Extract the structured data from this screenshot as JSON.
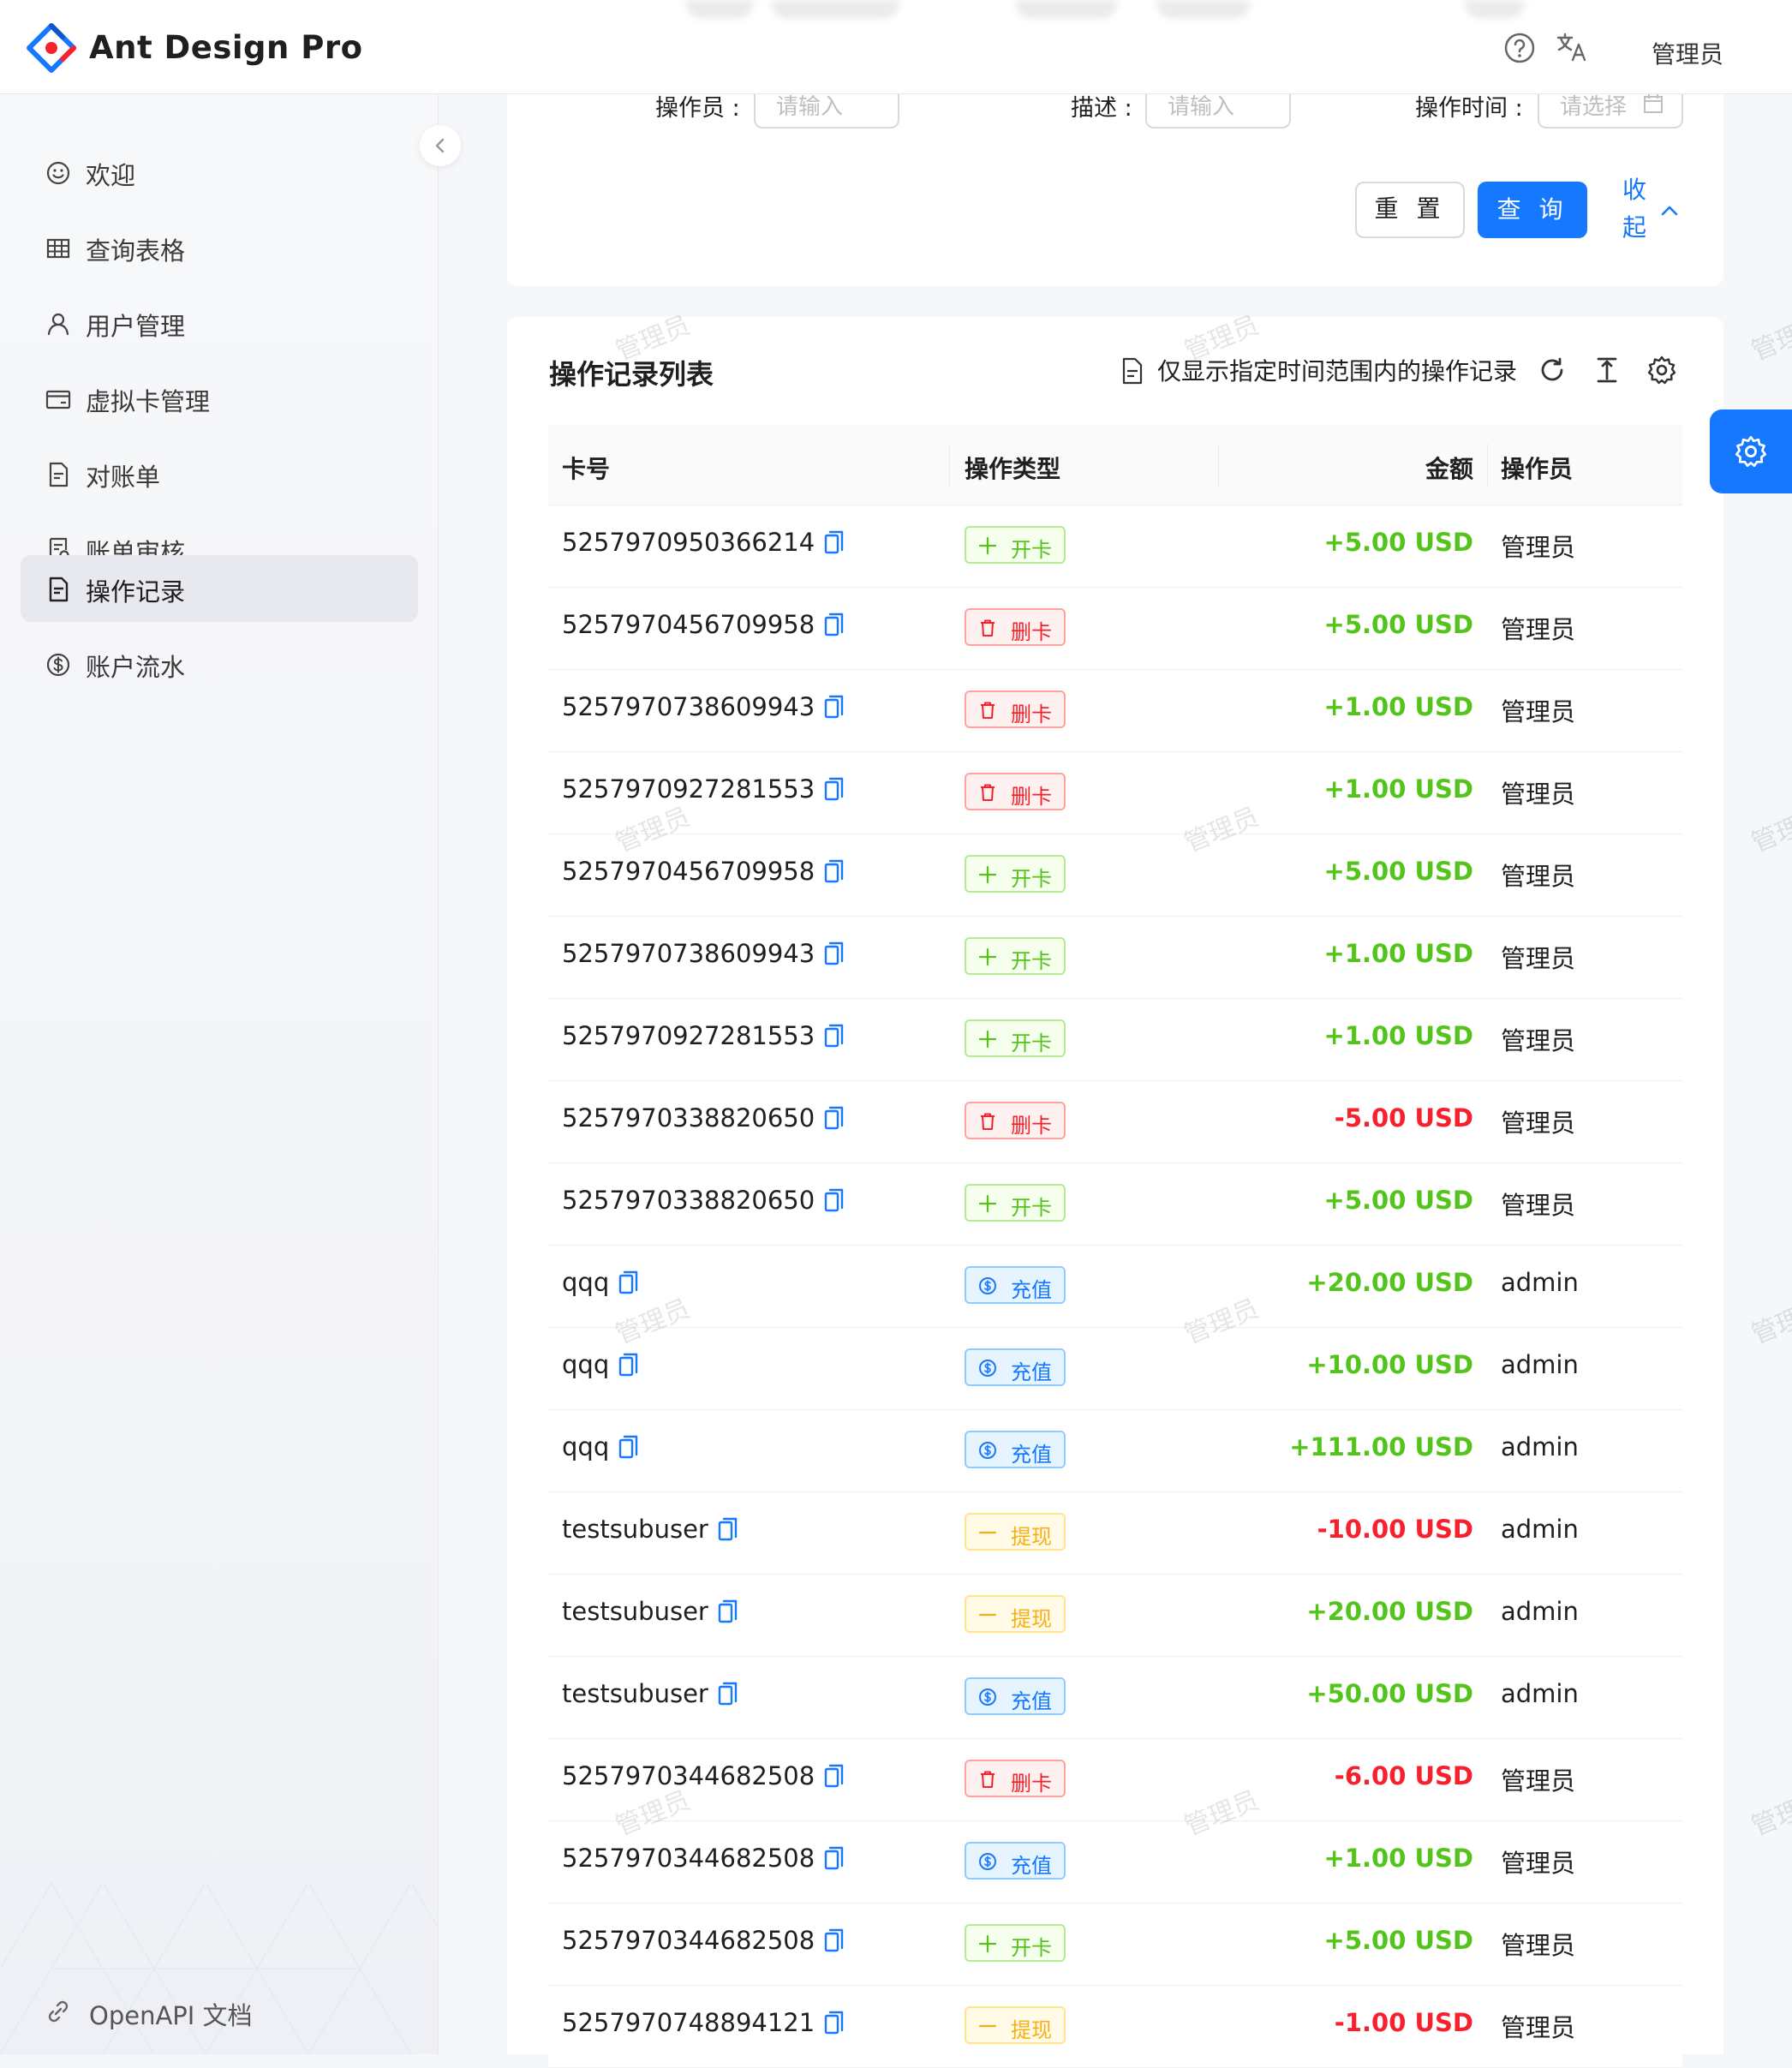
{
  "app": {
    "title": "Ant Design Pro"
  },
  "header": {
    "user": "管理员",
    "help_icon": "question-circle-icon",
    "lang_icon": "translation-icon"
  },
  "sidebar": {
    "items": [
      {
        "label": "欢迎",
        "icon": "smile-icon",
        "active": false
      },
      {
        "label": "查询表格",
        "icon": "table-icon",
        "active": false
      },
      {
        "label": "用户管理",
        "icon": "user-icon",
        "active": false
      },
      {
        "label": "虚拟卡管理",
        "icon": "credit-card-icon",
        "active": false
      },
      {
        "label": "对账单",
        "icon": "file-text-icon",
        "active": false
      },
      {
        "label": "账单审核",
        "icon": "audit-icon",
        "active": false
      },
      {
        "label": "操作记录",
        "icon": "file-text-icon",
        "active": true
      },
      {
        "label": "账户流水",
        "icon": "dollar-circle-icon",
        "active": false
      }
    ],
    "footer_link": "OpenAPI 文档"
  },
  "search": {
    "fields": [
      {
        "label": "操作员 :",
        "placeholder": "请输入"
      },
      {
        "label": "描述 :",
        "placeholder": "请输入"
      },
      {
        "label": "操作时间 :",
        "placeholder": "请选择"
      }
    ],
    "reset_label": "重 置",
    "query_label": "查 询",
    "collapse_label": "收起"
  },
  "table": {
    "title": "操作记录列表",
    "toolbar_note": "仅显示指定时间范围内的操作记录",
    "columns": [
      "卡号",
      "操作类型",
      "金额",
      "操作员"
    ],
    "rows": [
      {
        "card": "5257970950366214",
        "type": "开卡",
        "type_kind": "open",
        "amount": "+5.00 USD",
        "operator": "管理员"
      },
      {
        "card": "5257970456709958",
        "type": "删卡",
        "type_kind": "delete",
        "amount": "+5.00 USD",
        "operator": "管理员"
      },
      {
        "card": "5257970738609943",
        "type": "删卡",
        "type_kind": "delete",
        "amount": "+1.00 USD",
        "operator": "管理员"
      },
      {
        "card": "5257970927281553",
        "type": "删卡",
        "type_kind": "delete",
        "amount": "+1.00 USD",
        "operator": "管理员"
      },
      {
        "card": "5257970456709958",
        "type": "开卡",
        "type_kind": "open",
        "amount": "+5.00 USD",
        "operator": "管理员"
      },
      {
        "card": "5257970738609943",
        "type": "开卡",
        "type_kind": "open",
        "amount": "+1.00 USD",
        "operator": "管理员"
      },
      {
        "card": "5257970927281553",
        "type": "开卡",
        "type_kind": "open",
        "amount": "+1.00 USD",
        "operator": "管理员"
      },
      {
        "card": "5257970338820650",
        "type": "删卡",
        "type_kind": "delete",
        "amount": "-5.00 USD",
        "operator": "管理员"
      },
      {
        "card": "5257970338820650",
        "type": "开卡",
        "type_kind": "open",
        "amount": "+5.00 USD",
        "operator": "管理员"
      },
      {
        "card": "qqq",
        "type": "充值",
        "type_kind": "recharge",
        "amount": "+20.00 USD",
        "operator": "admin"
      },
      {
        "card": "qqq",
        "type": "充值",
        "type_kind": "recharge",
        "amount": "+10.00 USD",
        "operator": "admin"
      },
      {
        "card": "qqq",
        "type": "充值",
        "type_kind": "recharge",
        "amount": "+111.00 USD",
        "operator": "admin"
      },
      {
        "card": "testsubuser",
        "type": "提现",
        "type_kind": "withdraw",
        "amount": "-10.00 USD",
        "operator": "admin"
      },
      {
        "card": "testsubuser",
        "type": "提现",
        "type_kind": "withdraw",
        "amount": "+20.00 USD",
        "operator": "admin"
      },
      {
        "card": "testsubuser",
        "type": "充值",
        "type_kind": "recharge",
        "amount": "+50.00 USD",
        "operator": "admin"
      },
      {
        "card": "5257970344682508",
        "type": "删卡",
        "type_kind": "delete",
        "amount": "-6.00 USD",
        "operator": "管理员"
      },
      {
        "card": "5257970344682508",
        "type": "充值",
        "type_kind": "recharge",
        "amount": "+1.00 USD",
        "operator": "管理员"
      },
      {
        "card": "5257970344682508",
        "type": "开卡",
        "type_kind": "open",
        "amount": "+5.00 USD",
        "operator": "管理员"
      },
      {
        "card": "5257970748894121",
        "type": "提现",
        "type_kind": "withdraw",
        "amount": "-1.00 USD",
        "operator": "管理员"
      }
    ]
  },
  "watermark": "管理员",
  "colors": {
    "primary": "#1677ff",
    "positive": "#52c41a",
    "negative": "#f5222d",
    "warning": "#faad14"
  }
}
